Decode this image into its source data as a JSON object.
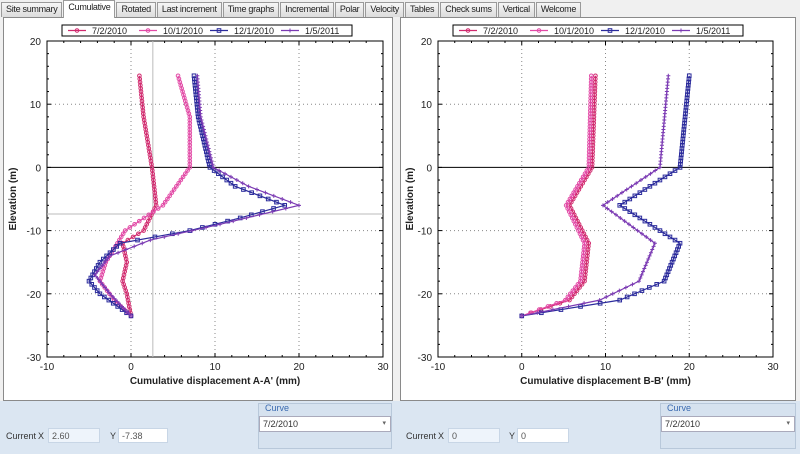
{
  "tabs": [
    "Site summary",
    "Cumulative",
    "Rotated",
    "Last increment",
    "Time graphs",
    "Incremental",
    "Polar",
    "Velocity",
    "Tables",
    "Check sums",
    "Vertical",
    "Welcome"
  ],
  "active_tab": 1,
  "left": {
    "current_label": "Current",
    "x_label": "X",
    "x_value": "2.60",
    "y_label": "Y",
    "y_value": "-7.38",
    "curve_title": "Curve",
    "curve_value": "7/2/2010"
  },
  "right": {
    "current_label": "Current",
    "x_label": "X",
    "x_value": "0",
    "y_label": "Y",
    "y_value": "0",
    "curve_title": "Curve",
    "curve_value": "7/2/2010"
  },
  "chart_data": [
    {
      "type": "line",
      "xlabel": "Cumulative displacement A-A' (mm)",
      "ylabel": "Elevation (m)",
      "xlim": [
        -10,
        30
      ],
      "ylim": [
        -30,
        20
      ],
      "xticks": [
        "-10",
        "0",
        "10",
        "20",
        "30"
      ],
      "yticks": [
        "20",
        "10",
        "0",
        "-10",
        "-20",
        "-30"
      ],
      "legend": "top",
      "cursor": [
        2.6,
        -7.38
      ],
      "series": [
        {
          "name": "7/2/2010",
          "color": "#d12a6e",
          "marker": "circle",
          "points": [
            [
              1,
              14.5
            ],
            [
              1.5,
              8
            ],
            [
              2.5,
              0
            ],
            [
              3,
              -6
            ],
            [
              1.5,
              -10
            ],
            [
              -1,
              -12
            ],
            [
              -0.5,
              -15
            ],
            [
              -1,
              -18
            ],
            [
              -0.5,
              -20
            ],
            [
              0,
              -23.5
            ]
          ]
        },
        {
          "name": "10/1/2010",
          "color": "#e24aa6",
          "marker": "circle",
          "points": [
            [
              5.6,
              14.5
            ],
            [
              7,
              8
            ],
            [
              7,
              0
            ],
            [
              3.8,
              -6
            ],
            [
              -0.7,
              -10
            ],
            [
              -3,
              -15
            ],
            [
              -3.7,
              -18
            ],
            [
              -2,
              -21
            ],
            [
              0,
              -23.5
            ]
          ]
        },
        {
          "name": "12/1/2010",
          "color": "#2b2b9c",
          "marker": "square",
          "points": [
            [
              7.5,
              14.5
            ],
            [
              8,
              8
            ],
            [
              9.4,
              0
            ],
            [
              12.4,
              -3
            ],
            [
              18.3,
              -6
            ],
            [
              13,
              -8
            ],
            [
              7,
              -10
            ],
            [
              -1.3,
              -12
            ],
            [
              -3.7,
              -15
            ],
            [
              -5,
              -18
            ],
            [
              -3.7,
              -20
            ],
            [
              0,
              -23.5
            ]
          ]
        },
        {
          "name": "1/5/2011",
          "color": "#7b3ab3",
          "marker": "plus",
          "points": [
            [
              7.9,
              14.5
            ],
            [
              8.3,
              8
            ],
            [
              9.8,
              0
            ],
            [
              14,
              -3
            ],
            [
              20,
              -6
            ],
            [
              10.6,
              -9
            ],
            [
              2.3,
              -11.5
            ],
            [
              -2.5,
              -14
            ],
            [
              -4.3,
              -17
            ],
            [
              -2.5,
              -20
            ],
            [
              0,
              -23.5
            ]
          ]
        }
      ]
    },
    {
      "type": "line",
      "xlabel": "Cumulative displacement B-B' (mm)",
      "ylabel": "Elevation (m)",
      "xlim": [
        -10,
        30
      ],
      "ylim": [
        -30,
        20
      ],
      "xticks": [
        "-10",
        "0",
        "10",
        "20",
        "30"
      ],
      "yticks": [
        "20",
        "10",
        "0",
        "-10",
        "-20",
        "-30"
      ],
      "legend": "top",
      "series": [
        {
          "name": "7/2/2010",
          "color": "#d12a6e",
          "marker": "circle",
          "points": [
            [
              8.8,
              14.5
            ],
            [
              8.4,
              0
            ],
            [
              5.7,
              -6
            ],
            [
              8,
              -12
            ],
            [
              7.5,
              -18
            ],
            [
              5.7,
              -21
            ],
            [
              0,
              -23.5
            ]
          ]
        },
        {
          "name": "10/1/2010",
          "color": "#e24aa6",
          "marker": "circle",
          "points": [
            [
              8.3,
              14.5
            ],
            [
              8,
              0
            ],
            [
              5.3,
              -6
            ],
            [
              7.5,
              -12
            ],
            [
              7,
              -18
            ],
            [
              5.2,
              -21
            ],
            [
              0,
              -23.5
            ]
          ]
        },
        {
          "name": "12/1/2010",
          "color": "#2b2b9c",
          "marker": "square",
          "points": [
            [
              20,
              14.5
            ],
            [
              18.9,
              0
            ],
            [
              11.7,
              -6
            ],
            [
              18.9,
              -12
            ],
            [
              17,
              -18
            ],
            [
              11.7,
              -21
            ],
            [
              0,
              -23.5
            ]
          ]
        },
        {
          "name": "1/5/2011",
          "color": "#7b3ab3",
          "marker": "plus",
          "points": [
            [
              17.5,
              14.5
            ],
            [
              16.5,
              0
            ],
            [
              9.7,
              -6
            ],
            [
              15.9,
              -12
            ],
            [
              14,
              -18
            ],
            [
              9.3,
              -21
            ],
            [
              0,
              -23.5
            ]
          ]
        }
      ]
    }
  ]
}
